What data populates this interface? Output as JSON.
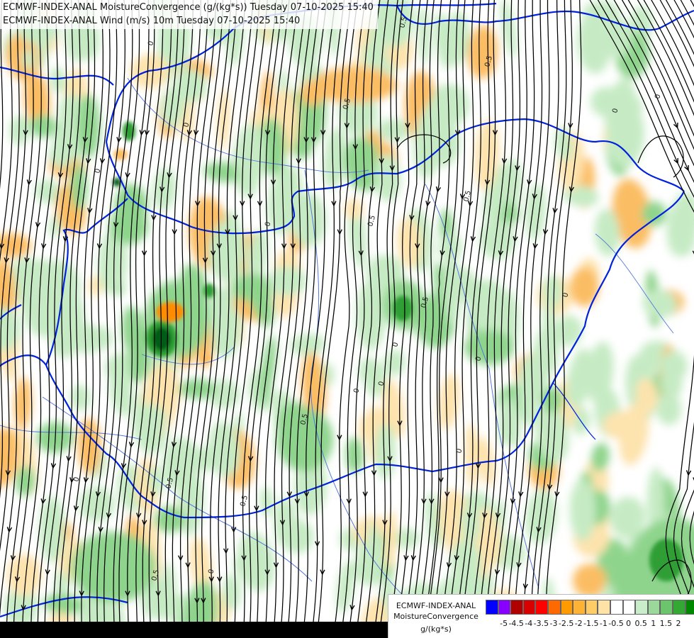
{
  "header": {
    "line1": "ECMWF-INDEX-ANAL MoistureConvergence (g/(kg*s)) Tuesday 07-10-2025 15:40",
    "line2": "ECMWF-INDEX-ANAL Wind (m/s) 10m Tuesday 07-10-2025 15:40"
  },
  "legend": {
    "model": "ECMWF-INDEX-ANAL",
    "parameter": "MoistureConvergence",
    "unit": "g/(kg*s)",
    "colors": [
      "#0000ff",
      "#8800ff",
      "#b00000",
      "#d80000",
      "#ff0000",
      "#ff6a00",
      "#ff9a00",
      "#ffb233",
      "#ffcc66",
      "#ffe2a6",
      "#ffffff",
      "#ffffff",
      "#c8edc8",
      "#9bd99b",
      "#6cc46c",
      "#33a833",
      "#008800"
    ],
    "tick_labels": [
      "-5",
      "-4.5",
      "-4",
      "-3.5",
      "-3",
      "-2.5",
      "-2",
      "-1.5",
      "-1",
      "-0.5",
      "0",
      "0.5",
      "1",
      "1.5",
      "2"
    ]
  },
  "map_labels": {
    "contour_value_a": "0",
    "contour_value_b": "0.5"
  },
  "colors": {
    "convergence_light": "#c6ebc4",
    "convergence_mid": "#8fd48d",
    "convergence_strong": "#2e9e35",
    "convergence_max": "#005c12",
    "divergence_light": "#fde3ad",
    "divergence_mid": "#fbbd63",
    "divergence_strong": "#ff8c00",
    "border": "#0022dd",
    "river": "#5577dd",
    "streamline": "#000000"
  }
}
